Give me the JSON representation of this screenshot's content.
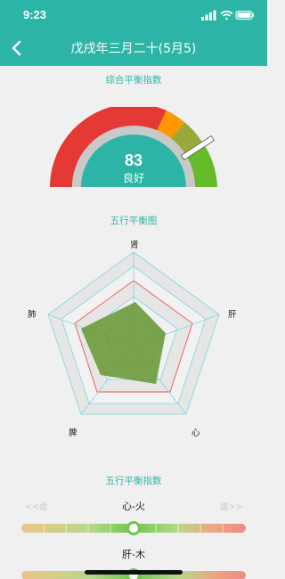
{
  "status": {
    "time": "9:23"
  },
  "nav": {
    "title": "戊戌年三月二十(5月5)"
  },
  "gauge": {
    "title": "综合平衡指数",
    "score": "83",
    "grade": "良好",
    "fraction": 0.83
  },
  "radar": {
    "title": "五行平衡图",
    "labels": {
      "top": "肾",
      "right": "肝",
      "bottom_right": "心",
      "bottom_left": "脾",
      "left": "肺"
    }
  },
  "balance": {
    "title": "五行平衡指数",
    "weak_label": "<<虚",
    "strong_label": "盛>>",
    "items": [
      {
        "name": "心-火",
        "position": 0.5
      },
      {
        "name": "肝-木",
        "position": 0.5
      }
    ]
  },
  "colors": {
    "teal": "#2cb5a6",
    "red": "#e53935",
    "orange": "#ff9800",
    "olive": "#9aa83a",
    "green": "#66bb2a",
    "radar_fill": "#6b9a3a"
  }
}
